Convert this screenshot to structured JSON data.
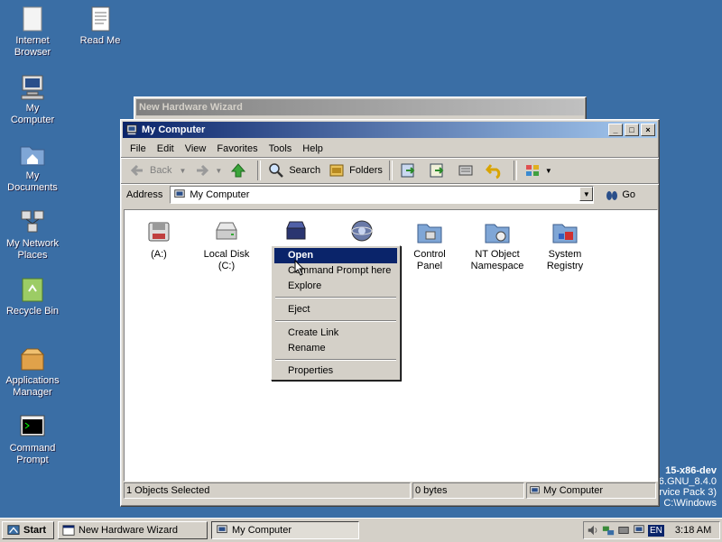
{
  "desktop": {
    "icons": [
      {
        "label_1": "Internet",
        "label_2": "Browser"
      },
      {
        "label_1": "Read Me",
        "label_2": ""
      },
      {
        "label_1": "My",
        "label_2": "Computer"
      },
      {
        "label_1": "My",
        "label_2": "Documents"
      },
      {
        "label_1": "My Network",
        "label_2": "Places"
      },
      {
        "label_1": "Recycle Bin",
        "label_2": ""
      },
      {
        "label_1": "Applications",
        "label_2": "Manager"
      },
      {
        "label_1": "Command",
        "label_2": "Prompt"
      }
    ],
    "version_lines": [
      "15-x86-dev",
      "i6.GNU_8.4.0",
      "rvice Pack 3)",
      "C:\\Windows"
    ]
  },
  "background_window": {
    "title": "New Hardware Wizard"
  },
  "window": {
    "title": "My Computer",
    "controls": {
      "minimize": "_",
      "maximize": "□",
      "close": "×"
    },
    "menu": [
      "File",
      "Edit",
      "View",
      "Favorites",
      "Tools",
      "Help"
    ],
    "toolbar": {
      "back": "Back",
      "search": "Search",
      "folders": "Folders"
    },
    "address": {
      "label": "Address",
      "value": "My Computer",
      "go": "Go"
    },
    "items": [
      {
        "label_1": "(A:)",
        "label_2": ""
      },
      {
        "label_1": "Local Disk",
        "label_2": "(C:)"
      },
      {
        "label_1": "",
        "label_2": ""
      },
      {
        "label_1": "",
        "label_2": ""
      },
      {
        "label_1": "Control",
        "label_2": "Panel"
      },
      {
        "label_1": "NT Object",
        "label_2": "Namespace"
      },
      {
        "label_1": "System",
        "label_2": "Registry"
      }
    ],
    "status": {
      "selected": "1 Objects Selected",
      "size": "0 bytes",
      "location": "My Computer"
    }
  },
  "context_menu": {
    "items": [
      "Open",
      "Command Prompt here",
      "Explore",
      "Eject",
      "Create Link",
      "Rename",
      "Properties"
    ]
  },
  "taskbar": {
    "start": "Start",
    "tasks": [
      "New Hardware Wizard",
      "My Computer"
    ],
    "lang": "EN",
    "clock": "3:18 AM"
  },
  "colors": {
    "desktop": "#3a6ea5",
    "title_active": "#0a246a",
    "selection": "#0a246a"
  }
}
